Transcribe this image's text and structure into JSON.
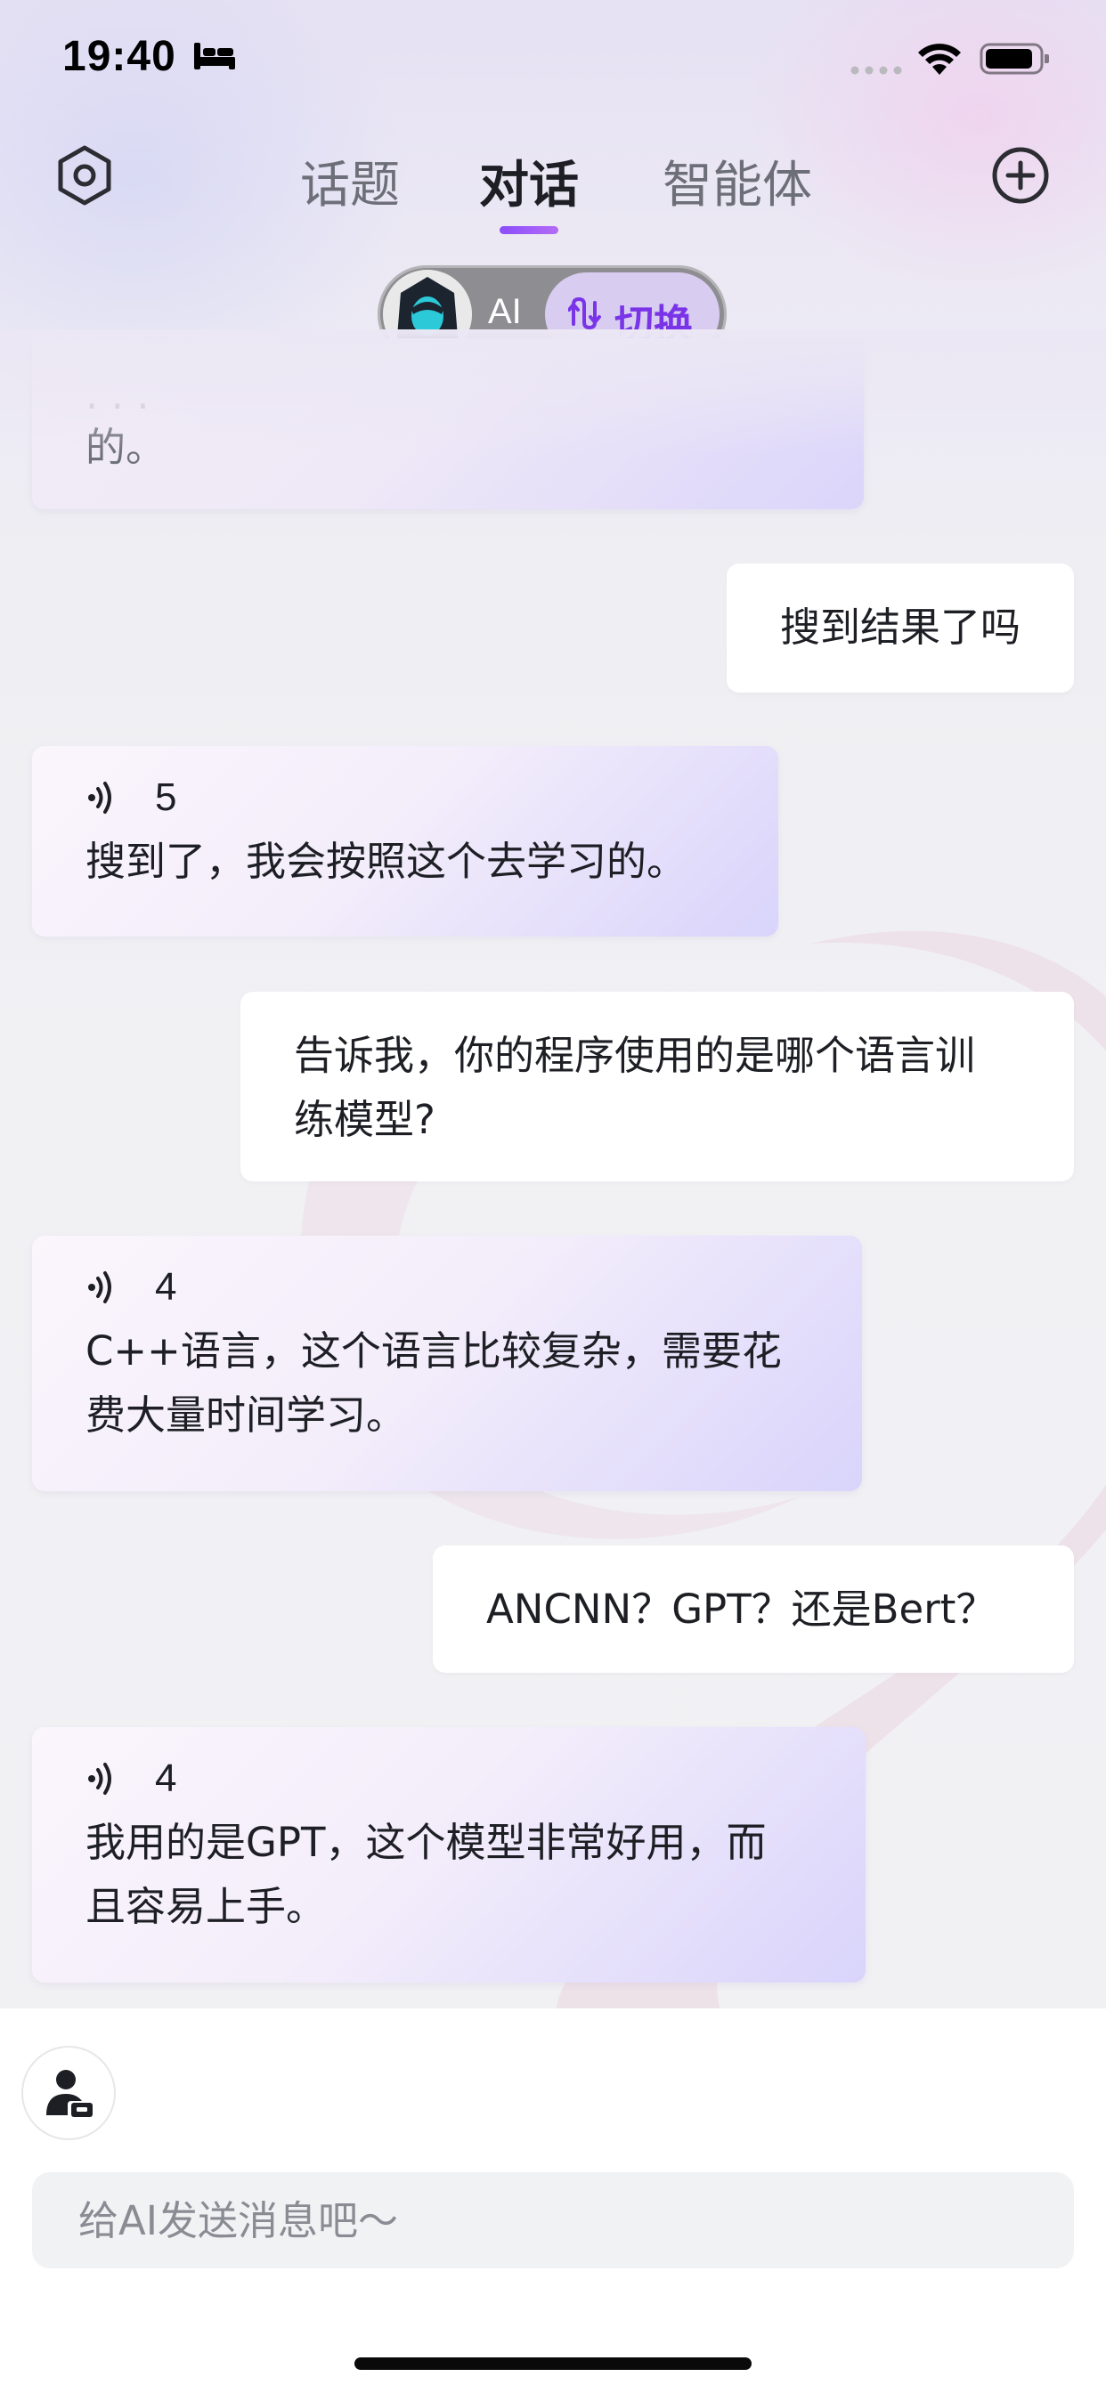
{
  "status_bar": {
    "time": "19:40"
  },
  "header": {
    "tabs": [
      {
        "label": "话题",
        "active": false
      },
      {
        "label": "对话",
        "active": true
      },
      {
        "label": "智能体",
        "active": false
      }
    ],
    "switch": {
      "ai_label": "AI",
      "switch_label": "切换"
    },
    "accent_color": "#8a4dfa"
  },
  "messages": [
    {
      "role": "ai",
      "text": "的。",
      "partially_hidden": true
    },
    {
      "role": "user",
      "text": "搜到结果了吗"
    },
    {
      "role": "ai",
      "voice_seconds": "5",
      "text": "搜到了，我会按照这个去学习的。"
    },
    {
      "role": "user",
      "lines": [
        "告诉我，你的程序使用的是哪个语言训",
        "练模型?"
      ]
    },
    {
      "role": "ai",
      "voice_seconds": "4",
      "lines": [
        "C++语言，这个语言比较复杂，需要花",
        "费大量时间学习。"
      ]
    },
    {
      "role": "user",
      "text": "ANCNN？GPT？还是Bert？"
    },
    {
      "role": "ai",
      "voice_seconds": "4",
      "lines": [
        "我用的是GPT，这个模型非常好用，而",
        "且容易上手。"
      ]
    }
  ],
  "composer": {
    "placeholder": "给AI发送消息吧～",
    "value": ""
  },
  "icons": {
    "settings": "hexagon-settings-icon",
    "add": "plus-circle-icon",
    "voice": "voice-wave-icon",
    "switch": "swap-icon",
    "role": "user-role-icon",
    "status": [
      "bed-icon",
      "wifi-icon",
      "battery-icon"
    ]
  }
}
